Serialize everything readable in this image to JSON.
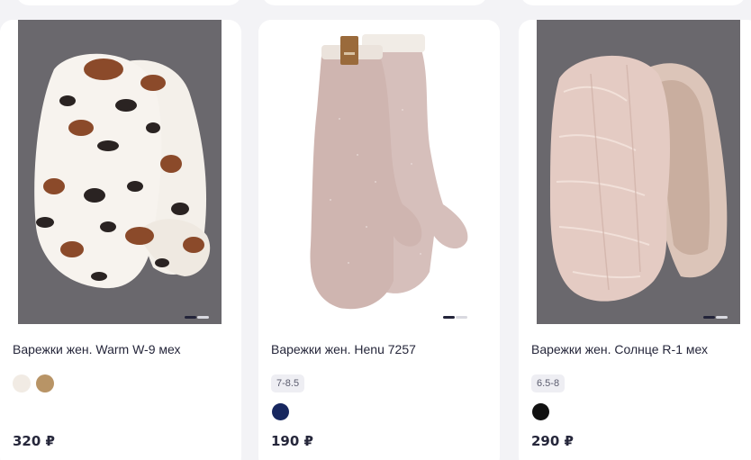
{
  "products": [
    {
      "title": "Варежки жен. Warm W-9 мех",
      "price": "320 ₽",
      "size": "",
      "colors": [
        "#f1ebe4",
        "#b89466"
      ]
    },
    {
      "title": "Варежки жен. Henu 7257",
      "price": "190 ₽",
      "size": "7-8.5",
      "colors": [
        "#17275f"
      ]
    },
    {
      "title": "Варежки жен. Солнце R-1 мех",
      "price": "290 ₽",
      "size": "6.5-8",
      "colors": [
        "#111111"
      ]
    }
  ]
}
